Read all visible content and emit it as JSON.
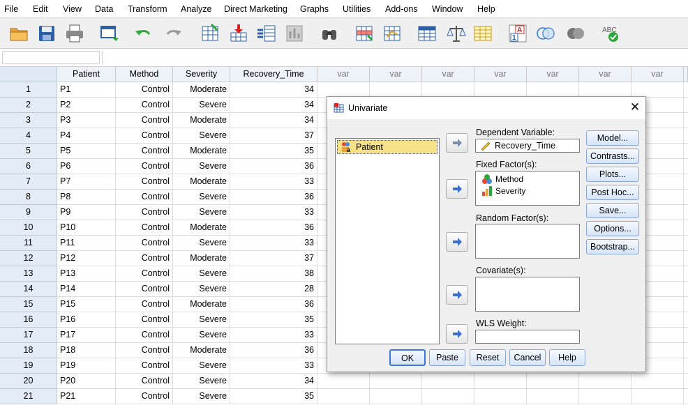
{
  "menu": [
    "File",
    "Edit",
    "View",
    "Data",
    "Transform",
    "Analyze",
    "Direct Marketing",
    "Graphs",
    "Utilities",
    "Add-ons",
    "Window",
    "Help"
  ],
  "toolbar_icons": [
    "open-folder-icon",
    "save-icon",
    "print-icon",
    "dialog-recall-icon",
    "undo-icon",
    "redo-icon",
    "goto-case-icon",
    "goto-variable-icon",
    "variables-icon",
    "run-descriptive-icon",
    "find-icon",
    "insert-cases-icon",
    "insert-variable-icon",
    "split-file-icon",
    "weight-cases-icon",
    "select-cases-icon",
    "value-labels-icon",
    "use-variable-sets-icon",
    "show-all-variables-icon",
    "spell-check-icon"
  ],
  "toolbar_spell_label": "ABC",
  "grid": {
    "columns": [
      "Patient",
      "Method",
      "Severity",
      "Recovery_Time",
      "var",
      "var",
      "var",
      "var",
      "var",
      "var",
      "var"
    ],
    "rows": [
      {
        "n": "1",
        "patient": "P1",
        "method": "Control",
        "severity": "Moderate",
        "time": "34"
      },
      {
        "n": "2",
        "patient": "P2",
        "method": "Control",
        "severity": "Severe",
        "time": "34"
      },
      {
        "n": "3",
        "patient": "P3",
        "method": "Control",
        "severity": "Moderate",
        "time": "34"
      },
      {
        "n": "4",
        "patient": "P4",
        "method": "Control",
        "severity": "Severe",
        "time": "37"
      },
      {
        "n": "5",
        "patient": "P5",
        "method": "Control",
        "severity": "Moderate",
        "time": "35"
      },
      {
        "n": "6",
        "patient": "P6",
        "method": "Control",
        "severity": "Severe",
        "time": "36"
      },
      {
        "n": "7",
        "patient": "P7",
        "method": "Control",
        "severity": "Moderate",
        "time": "33"
      },
      {
        "n": "8",
        "patient": "P8",
        "method": "Control",
        "severity": "Severe",
        "time": "36"
      },
      {
        "n": "9",
        "patient": "P9",
        "method": "Control",
        "severity": "Severe",
        "time": "33"
      },
      {
        "n": "10",
        "patient": "P10",
        "method": "Control",
        "severity": "Moderate",
        "time": "36"
      },
      {
        "n": "11",
        "patient": "P11",
        "method": "Control",
        "severity": "Severe",
        "time": "33"
      },
      {
        "n": "12",
        "patient": "P12",
        "method": "Control",
        "severity": "Moderate",
        "time": "37"
      },
      {
        "n": "13",
        "patient": "P13",
        "method": "Control",
        "severity": "Severe",
        "time": "38"
      },
      {
        "n": "14",
        "patient": "P14",
        "method": "Control",
        "severity": "Severe",
        "time": "28"
      },
      {
        "n": "15",
        "patient": "P15",
        "method": "Control",
        "severity": "Moderate",
        "time": "36"
      },
      {
        "n": "16",
        "patient": "P16",
        "method": "Control",
        "severity": "Severe",
        "time": "35"
      },
      {
        "n": "17",
        "patient": "P17",
        "method": "Control",
        "severity": "Severe",
        "time": "33"
      },
      {
        "n": "18",
        "patient": "P18",
        "method": "Control",
        "severity": "Moderate",
        "time": "36"
      },
      {
        "n": "19",
        "patient": "P19",
        "method": "Control",
        "severity": "Severe",
        "time": "33"
      },
      {
        "n": "20",
        "patient": "P20",
        "method": "Control",
        "severity": "Severe",
        "time": "34"
      },
      {
        "n": "21",
        "patient": "P21",
        "method": "Control",
        "severity": "Severe",
        "time": "35"
      }
    ]
  },
  "dialog": {
    "title": "Univariate",
    "source_items": [
      "Patient"
    ],
    "dependent_label": "Dependent Variable:",
    "dependent_value": "Recovery_Time",
    "fixed_label": "Fixed Factor(s):",
    "fixed_items": [
      "Method",
      "Severity"
    ],
    "random_label": "Random Factor(s):",
    "covariate_label": "Covariate(s):",
    "wls_label": "WLS Weight:",
    "side_buttons": [
      "Model...",
      "Contrasts...",
      "Plots...",
      "Post Hoc...",
      "Save...",
      "Options...",
      "Bootstrap..."
    ],
    "bottom_buttons": [
      "OK",
      "Paste",
      "Reset",
      "Cancel",
      "Help"
    ]
  },
  "colors": {
    "selected_item": "#f7e28a",
    "button_blue": "#d6e4f8",
    "row_header": "#e4ecf7"
  }
}
